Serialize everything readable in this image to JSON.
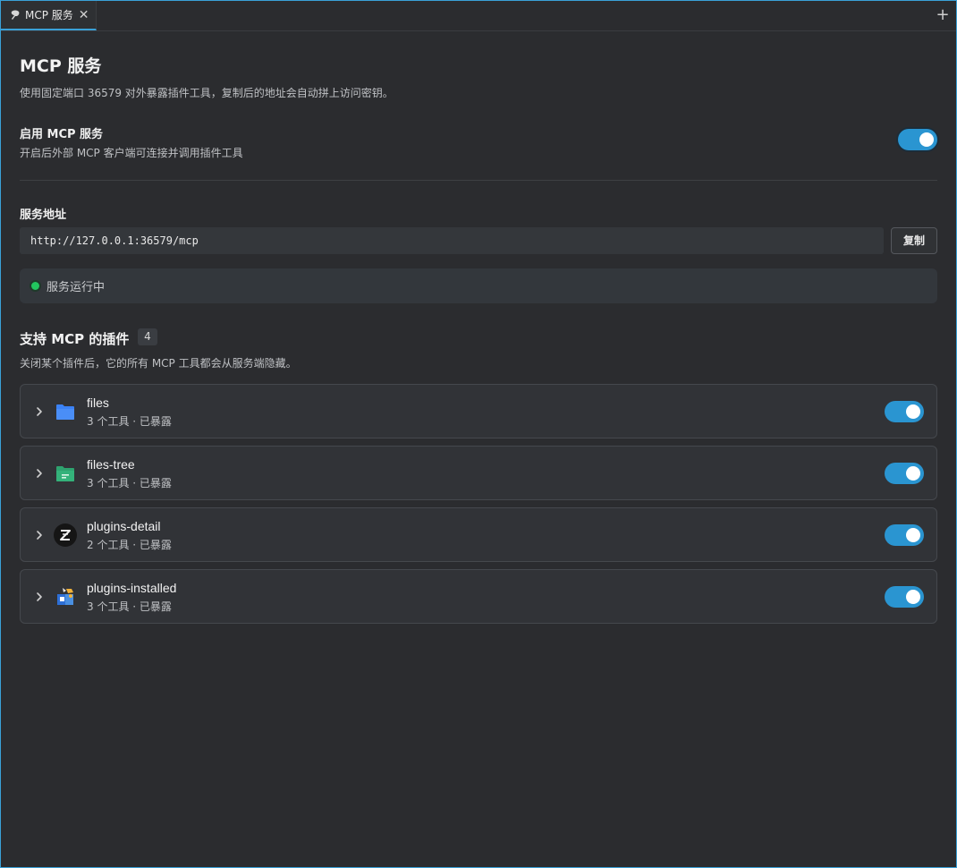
{
  "tab": {
    "label": "MCP 服务",
    "close": "✕",
    "add": "+"
  },
  "page": {
    "title": "MCP 服务",
    "description": "使用固定端口 36579 对外暴露插件工具，复制后的地址会自动拼上访问密钥。"
  },
  "enable": {
    "title": "启用 MCP 服务",
    "description": "开启后外部 MCP 客户端可连接并调用插件工具",
    "on": true
  },
  "address": {
    "label": "服务地址",
    "value": "http://127.0.0.1:36579/mcp",
    "copy_label": "复制"
  },
  "status": {
    "text": "服务运行中",
    "color": "#22c55e"
  },
  "plugins_section": {
    "title": "支持 MCP 的插件",
    "count": "4",
    "description": "关闭某个插件后，它的所有 MCP 工具都会从服务端隐藏。"
  },
  "plugins": [
    {
      "name": "files",
      "meta": "3 个工具 · 已暴露",
      "icon": "folder-icon",
      "enabled": true
    },
    {
      "name": "files-tree",
      "meta": "3 个工具 · 已暴露",
      "icon": "folder-tree-icon",
      "enabled": true
    },
    {
      "name": "plugins-detail",
      "meta": "2 个工具 · 已暴露",
      "icon": "plugin-detail-logo-icon",
      "enabled": true
    },
    {
      "name": "plugins-installed",
      "meta": "3 个工具 · 已暴露",
      "icon": "plugins-installed-icon",
      "enabled": true
    }
  ],
  "colors": {
    "accent": "#2a95d1",
    "background": "#2b2c2f",
    "card": "#313337"
  }
}
